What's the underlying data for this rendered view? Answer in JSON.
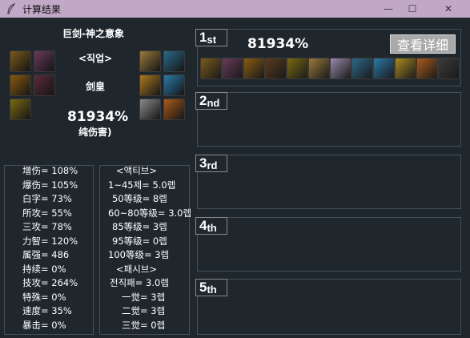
{
  "window": {
    "title": "计算结果",
    "controls": [
      "—",
      "☐",
      "✕"
    ]
  },
  "character": {
    "name": "巨剑-神之意象",
    "job_header": "<직업>",
    "job": "剑皇",
    "damage": "81934%",
    "damage_note": "纯伤害)"
  },
  "left_icons": [
    {
      "name": "weapon-slot-1-icon",
      "color": "#7a5a1a"
    },
    {
      "name": "weapon-slot-2-icon",
      "color": "#6a3a5a"
    },
    {
      "name": "armor-slot-1-icon",
      "color": "#8a5a10"
    },
    {
      "name": "armor-slot-2-icon",
      "color": "#5a2a3a"
    },
    {
      "name": "armor-slot-3-icon",
      "color": "#7a6a10"
    }
  ],
  "right_icons": [
    {
      "name": "accessory-slot-1-icon",
      "color": "#9a7a3a"
    },
    {
      "name": "accessory-slot-2-icon",
      "color": "#2a6a8a"
    },
    {
      "name": "accessory-slot-3-icon",
      "color": "#aa7a20"
    },
    {
      "name": "accessory-slot-4-icon",
      "color": "#2a7aaa"
    },
    {
      "name": "accessory-slot-5-icon",
      "color": "#8a8a8a"
    },
    {
      "name": "accessory-slot-6-icon",
      "color": "#aa5a1a"
    }
  ],
  "stats_left": [
    "增伤= 108%",
    "爆伤= 105%",
    "白字= 73%",
    "所攻= 55%",
    "三攻= 78%",
    "力智= 120%",
    "属强= 486",
    "持续= 0%",
    "技攻= 264%",
    "特殊= 0%",
    "",
    "速度= 35%",
    "暴击= 0%"
  ],
  "stats_right": [
    "<액티브>",
    "1~45제= 5.0렙",
    "50等级= 8렙",
    "60~80等级= 3.0렙",
    "85等级= 3렙",
    "95等级= 0렙",
    "100等级= 3렙",
    "",
    "<패시브>",
    "전직패= 3.0렙",
    "一觉= 3렙",
    "二觉= 3렙",
    "三觉= 0렙"
  ],
  "results": {
    "rank1": {
      "label": "1",
      "suffix": "st",
      "damage": "81934%",
      "detail_button": "查看详细"
    },
    "rank2": {
      "label": "2",
      "suffix": "nd"
    },
    "rank3": {
      "label": "3",
      "suffix": "rd"
    },
    "rank4": {
      "label": "4",
      "suffix": "th"
    },
    "rank5": {
      "label": "5",
      "suffix": "th"
    }
  },
  "rank1_icons": [
    {
      "name": "equip-1-icon",
      "color": "#7a5a1a"
    },
    {
      "name": "equip-2-icon",
      "color": "#6a3a5a"
    },
    {
      "name": "equip-3-icon",
      "color": "#8a5a10"
    },
    {
      "name": "equip-4-icon",
      "color": "#5a3a1a"
    },
    {
      "name": "equip-5-icon",
      "color": "#7a6a10"
    },
    {
      "name": "equip-6-icon",
      "color": "#9a7a3a"
    },
    {
      "name": "equip-7-icon",
      "color": "#9a8aaa"
    },
    {
      "name": "equip-8-icon",
      "color": "#2a6a8a"
    },
    {
      "name": "equip-9-icon",
      "color": "#2a7aaa"
    },
    {
      "name": "equip-10-icon",
      "color": "#aa8a20"
    },
    {
      "name": "equip-11-icon",
      "color": "#aa5a1a"
    },
    {
      "name": "equip-12-icon",
      "color": "#3a3a3a"
    }
  ]
}
